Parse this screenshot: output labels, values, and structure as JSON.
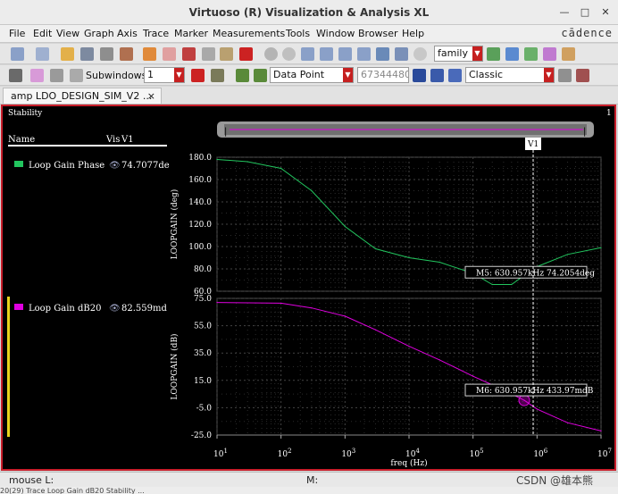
{
  "window": {
    "title": "Virtuoso (R) Visualization & Analysis XL",
    "brand": "cādence"
  },
  "menus": [
    "File",
    "Edit",
    "View",
    "Graph",
    "Axis",
    "Trace",
    "Marker",
    "Measurements",
    "Tools",
    "Window",
    "Browser",
    "Help"
  ],
  "toolbar": {
    "family_value": "family",
    "subwindows_label": "Subwindows:",
    "subwindows_value": "1",
    "marker_mode": "Data Point",
    "readout": "67344480k",
    "style": "Classic"
  },
  "tab": {
    "label": "amp LDO_DESIGN_SIM_V2 ...",
    "close": "×"
  },
  "panel": {
    "title": "Stability",
    "index": "1"
  },
  "legend": {
    "col_name": "Name",
    "col_vis": "Vis",
    "col_v1": "V1",
    "traces": [
      {
        "name": "Loop Gain Phase",
        "value": "74.7077de",
        "color": "#22c55e"
      },
      {
        "name": "Loop Gain dB20",
        "value": "82.559md",
        "color": "#e000e0"
      }
    ]
  },
  "vmarker": {
    "label": "V1"
  },
  "chart_data": [
    {
      "type": "line",
      "title": "",
      "xlabel": "freq (Hz)",
      "ylabel": "LOOPGAIN (deg)",
      "xscale": "log",
      "xlim": [
        10,
        10000000
      ],
      "ylim": [
        60,
        180
      ],
      "yticks": [
        "180.0",
        "160.0",
        "140.0",
        "120.0",
        "100.0",
        "80.0",
        "60.0"
      ],
      "series": [
        {
          "name": "Loop Gain Phase",
          "color": "#22c55e",
          "x": [
            10,
            30,
            100,
            300,
            1000,
            3000,
            10000,
            30000,
            100000,
            200000,
            400000,
            630957,
            1000000,
            3000000,
            10000000
          ],
          "y": [
            178,
            176,
            170,
            150,
            118,
            98,
            90,
            86,
            76,
            66,
            66,
            74.2,
            82,
            93,
            99
          ]
        }
      ],
      "annotation": "M5: 630.957kHz 74.2054deg"
    },
    {
      "type": "line",
      "title": "",
      "xlabel": "freq (Hz)",
      "ylabel": "LOOPGAIN (dB)",
      "xscale": "log",
      "xlim": [
        10,
        10000000
      ],
      "ylim": [
        -25,
        75
      ],
      "yticks": [
        "75.0",
        "55.0",
        "35.0",
        "15.0",
        "-5.0",
        "-25.0"
      ],
      "xticks": [
        "10^1",
        "10^2",
        "10^3",
        "10^4",
        "10^5",
        "10^6",
        "10^7"
      ],
      "series": [
        {
          "name": "Loop Gain dB20",
          "color": "#e000e0",
          "x": [
            10,
            100,
            300,
            1000,
            3000,
            10000,
            30000,
            100000,
            300000,
            630957,
            1000000,
            3000000,
            10000000
          ],
          "y": [
            72,
            71.5,
            68,
            62,
            52,
            40,
            30,
            18,
            8,
            0.434,
            -6,
            -16,
            -22
          ]
        }
      ],
      "annotation": "M6: 630.957kHz 433.97mdB"
    }
  ],
  "status": {
    "mouse": "mouse L:",
    "m": "M:",
    "line2": "20(29) Trace Loop Gain dB20 Stability ..."
  },
  "watermark": "CSDN @雄本熊"
}
